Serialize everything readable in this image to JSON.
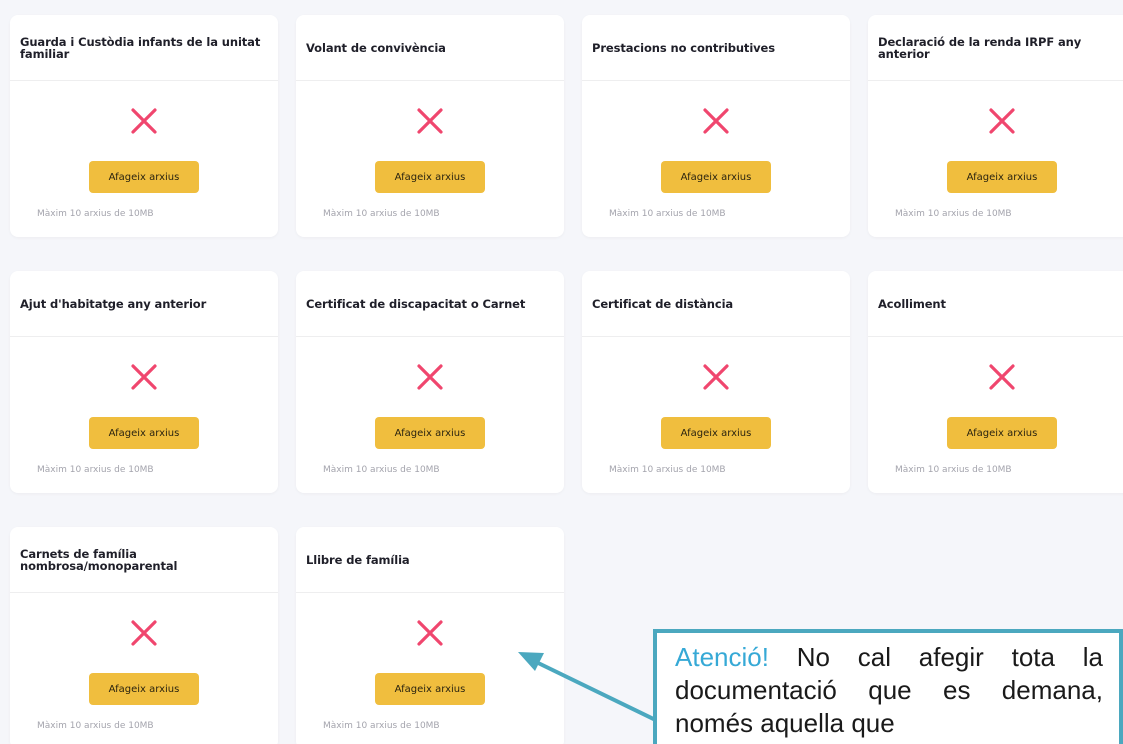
{
  "cards": [
    {
      "title": "Guarda i Custòdia infants de la unitat familiar",
      "button_label": "Afageix arxius",
      "limit_text": "Màxim 10 arxius de 10MB",
      "status_icon": "x-mark-icon"
    },
    {
      "title": "Volant de convivència",
      "button_label": "Afageix arxius",
      "limit_text": "Màxim 10 arxius de 10MB",
      "status_icon": "x-mark-icon"
    },
    {
      "title": "Prestacions no contributives",
      "button_label": "Afageix arxius",
      "limit_text": "Màxim 10 arxius de 10MB",
      "status_icon": "x-mark-icon"
    },
    {
      "title": "Declaració de la renda IRPF any anterior",
      "button_label": "Afageix arxius",
      "limit_text": "Màxim 10 arxius de 10MB",
      "status_icon": "x-mark-icon"
    },
    {
      "title": "Ajut d'habitatge any anterior",
      "button_label": "Afageix arxius",
      "limit_text": "Màxim 10 arxius de 10MB",
      "status_icon": "x-mark-icon"
    },
    {
      "title": "Certificat de discapacitat o Carnet",
      "button_label": "Afageix arxius",
      "limit_text": "Màxim 10 arxius de 10MB",
      "status_icon": "x-mark-icon"
    },
    {
      "title": "Certificat de distància",
      "button_label": "Afageix arxius",
      "limit_text": "Màxim 10 arxius de 10MB",
      "status_icon": "x-mark-icon"
    },
    {
      "title": "Acolliment",
      "button_label": "Afageix arxius",
      "limit_text": "Màxim 10 arxius de 10MB",
      "status_icon": "x-mark-icon"
    },
    {
      "title": "Carnets de família nombrosa/monoparental",
      "button_label": "Afageix arxius",
      "limit_text": "Màxim 10 arxius de 10MB",
      "status_icon": "x-mark-icon"
    },
    {
      "title": "Llibre de família",
      "button_label": "Afageix arxius",
      "limit_text": "Màxim 10 arxius de 10MB",
      "status_icon": "x-mark-icon"
    }
  ],
  "callout": {
    "lead": "Atenció!",
    "text": " No cal afegir tota la documentació que es demana, només aquella que"
  },
  "colors": {
    "x_mark": "#f0466e",
    "button": "#f0be3e",
    "callout_border": "#4ba8bf",
    "callout_lead": "#36a9d6",
    "arrow": "#4ba8bf"
  }
}
